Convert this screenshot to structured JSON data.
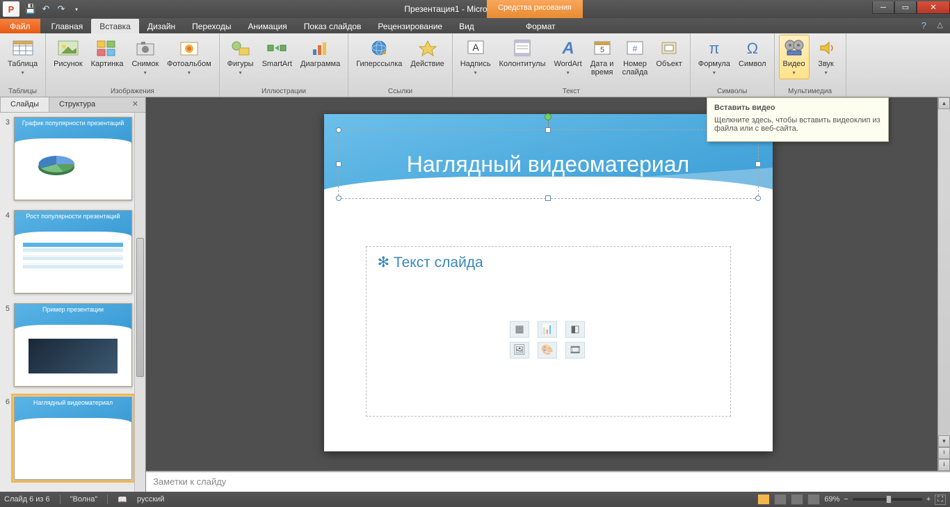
{
  "title": "Презентация1 - Microsoft PowerPoint",
  "drawing_tools": "Средства рисования",
  "file_tab": "Файл",
  "tabs": {
    "home": "Главная",
    "insert": "Вставка",
    "design": "Дизайн",
    "transitions": "Переходы",
    "animations": "Анимация",
    "slideshow": "Показ слайдов",
    "review": "Рецензирование",
    "view": "Вид",
    "format": "Формат"
  },
  "ribbon": {
    "groups": {
      "tables": "Таблицы",
      "images": "Изображения",
      "illustrations": "Иллюстрации",
      "links": "Ссылки",
      "text": "Текст",
      "symbols": "Символы",
      "media": "Мультимедиа"
    },
    "buttons": {
      "table": "Таблица",
      "picture": "Рисунок",
      "clipart": "Картинка",
      "screenshot": "Снимок",
      "photoalbum": "Фотоальбом",
      "shapes": "Фигуры",
      "smartart": "SmartArt",
      "chart": "Диаграмма",
      "hyperlink": "Гиперссылка",
      "action": "Действие",
      "textbox": "Надпись",
      "headerfooter": "Колонтитулы",
      "wordart": "WordArt",
      "datetime": "Дата и\nвремя",
      "slidenum": "Номер\nслайда",
      "object": "Объект",
      "equation": "Формула",
      "symbol": "Символ",
      "video": "Видео",
      "audio": "Звук"
    }
  },
  "side": {
    "tab_slides": "Слайды",
    "tab_outline": "Структура",
    "thumbs": [
      {
        "num": "3",
        "title": "График популярности презентаций"
      },
      {
        "num": "4",
        "title": "Рост популярности презентаций"
      },
      {
        "num": "5",
        "title": "Пример презентации"
      },
      {
        "num": "6",
        "title": "Наглядный видеоматериал"
      }
    ]
  },
  "slide": {
    "title": "Наглядный видеоматериал",
    "content_placeholder": "Текст слайда"
  },
  "notes_placeholder": "Заметки к слайду",
  "tooltip": {
    "title": "Вставить видео",
    "body": "Щелкните здесь, чтобы вставить видеоклип из файла или с веб-сайта."
  },
  "status": {
    "slide_of": "Слайд 6 из 6",
    "theme": "\"Волна\"",
    "language": "русский",
    "zoom": "69%"
  }
}
